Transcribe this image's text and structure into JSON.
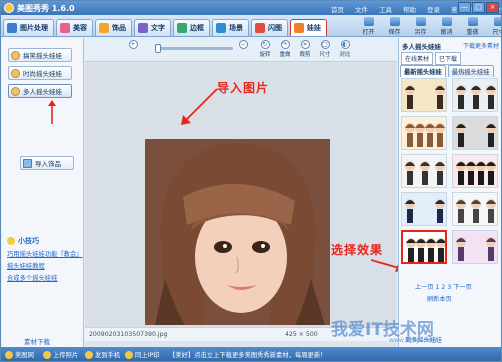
{
  "window": {
    "title": "美图秀秀 1.6.0",
    "menu": [
      "首页",
      "文件",
      "工具",
      "帮助",
      "登录",
      "意见建议",
      "换肤"
    ],
    "controls": [
      "—",
      "□",
      "×"
    ]
  },
  "tabs": [
    {
      "label": "图片处理",
      "color": "#3b7bd2"
    },
    {
      "label": "美容",
      "color": "#e9608a"
    },
    {
      "label": "饰品",
      "color": "#f4a52b"
    },
    {
      "label": "文字",
      "color": "#7b61c9"
    },
    {
      "label": "边框",
      "color": "#3aa66b"
    },
    {
      "label": "场景",
      "color": "#2e8fcf"
    },
    {
      "label": "闪图",
      "color": "#e04b3b"
    },
    {
      "label": "娃娃",
      "color": "#f07f2a"
    }
  ],
  "toolbar_right": [
    "打开",
    "保存",
    "另存",
    "撤消",
    "重做",
    "尺寸"
  ],
  "left_panel": {
    "buttons": [
      "搞笑摇头娃娃",
      "时尚摇头娃娃",
      "多人摇头娃娃"
    ],
    "import_button": "导入饰品",
    "tip_title": "小技巧",
    "tip_links": [
      "巧用摇头娃娃功能『教会』",
      "摇头娃娃教程",
      "合成多个摇头娃娃"
    ],
    "bottom_link": "素材下载"
  },
  "canvas": {
    "tools": [
      "旋转",
      "重做",
      "裁剪",
      "尺寸",
      "对比"
    ],
    "filename": "20090203103507390.jpg",
    "dimensions": "425 × 500"
  },
  "annotations": {
    "import_label": "导入图片",
    "select_label": "选择效果"
  },
  "right_panel": {
    "title": "多人摇头娃娃",
    "download_link": "下载更多素材",
    "sub_options": [
      "在线素材",
      "已下载"
    ],
    "tabs": [
      "最新摇头娃娃",
      "最热摇头娃娃"
    ],
    "thumbnails": [
      "thumb-1",
      "thumb-2",
      "thumb-3",
      "thumb-4",
      "thumb-5",
      "thumb-6",
      "thumb-7",
      "thumb-8",
      "thumb-9",
      "thumb-10"
    ],
    "pager": "上一页 1 2 3 下一页",
    "refresh": "刷新本页",
    "more": "更多摇头娃娃"
  },
  "bottom_bar": {
    "items": [
      "美图网",
      "上传照片",
      "发到手机",
      "同上IP印"
    ],
    "news": "【美好】点击立上下载更多美图秀秀新素材，每周更新！"
  },
  "watermark": {
    "text": "我爱IT技术网",
    "url": "www.52itjs.com"
  }
}
